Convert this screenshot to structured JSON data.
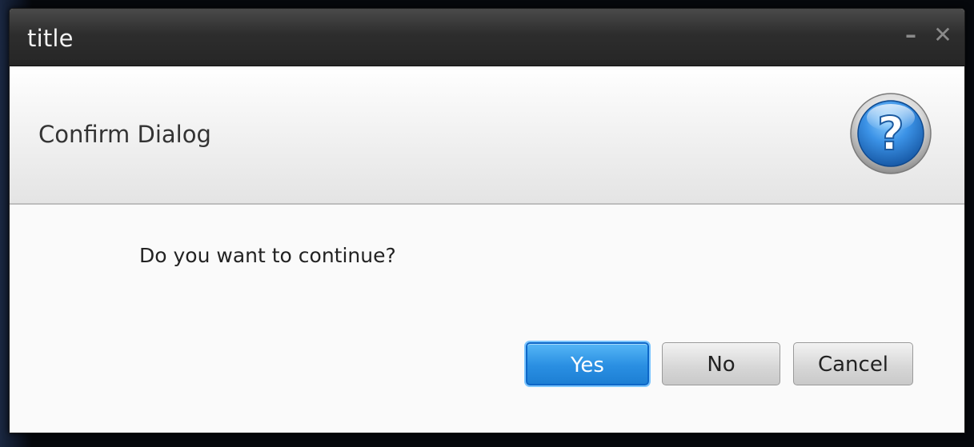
{
  "window": {
    "title": "title",
    "minimize_glyph": "–",
    "close_glyph": "✕"
  },
  "header": {
    "text": "Confirm Dialog",
    "icon": "question-icon",
    "icon_glyph": "?"
  },
  "content": {
    "message": "Do you want to continue?"
  },
  "buttons": {
    "yes_label": "Yes",
    "no_label": "No",
    "cancel_label": "Cancel"
  },
  "colors": {
    "titlebar": "#2d2d2d",
    "default_button": "#2a8fe2",
    "icon_blue": "#2f7fd6"
  }
}
